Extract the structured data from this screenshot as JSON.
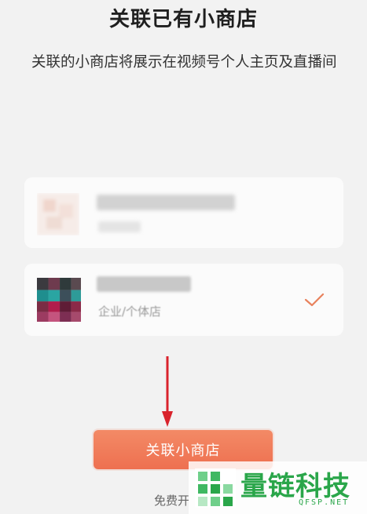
{
  "page": {
    "title": "关联已有小商店",
    "subtitle": "关联的小商店将展示在视频号个人主页及直播间"
  },
  "stores": [
    {
      "subtitle": "",
      "selected": false
    },
    {
      "subtitle": "企业/个体店",
      "selected": true
    }
  ],
  "action": {
    "link_button_label": "关联小商店"
  },
  "footer": {
    "text": "免费开"
  },
  "watermark": {
    "name": "量链科技",
    "domain": "QFSP.NET"
  },
  "colors": {
    "accent": "#ee7050",
    "check": "#e8825d",
    "arrow": "#d9232c",
    "watermark_green": "#2aa64a"
  },
  "icons": {
    "selected": "check-icon",
    "annotation": "arrow-down-icon"
  }
}
